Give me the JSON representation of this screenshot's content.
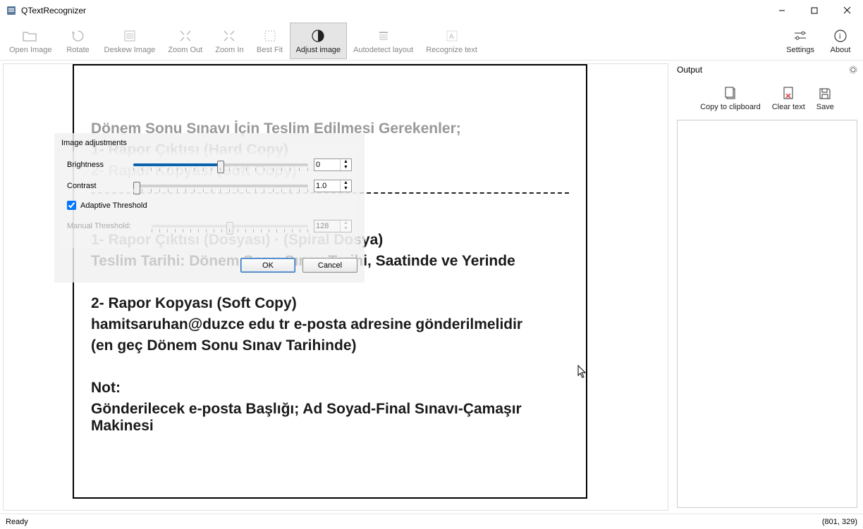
{
  "app": {
    "title": "QTextRecognizer"
  },
  "toolbar": {
    "open": "Open Image",
    "rotate": "Rotate",
    "deskew": "Deskew Image",
    "zoom_out": "Zoom Out",
    "zoom_in": "Zoom In",
    "best_fit": "Best Fit",
    "adjust": "Adjust image",
    "autodetect": "Autodetect layout",
    "recognize": "Recognize text",
    "settings": "Settings",
    "about": "About"
  },
  "output": {
    "title": "Output",
    "copy": "Copy to clipboard",
    "clear": "Clear text",
    "save": "Save"
  },
  "dialog": {
    "title": "Image adjustments",
    "brightness_label": "Brightness",
    "brightness_value": "0",
    "contrast_label": "Contrast",
    "contrast_value": "1.0",
    "adaptive_label": "Adaptive Threshold",
    "adaptive_checked": true,
    "manual_label": "Manual Threshold:",
    "manual_value": "128",
    "ok": "OK",
    "cancel": "Cancel"
  },
  "document": {
    "l1": "Dönem Sonu Sınavı İçin Teslim Edilmesi Gerekenler;",
    "l2": "1- Rapor Çıktısı (Hard Copy)",
    "l3": "2- Rapor Kopyası (Soft Copy)",
    "l4": "1- Rapor Çıktısı (Dosyası)   ·   (Spiral Dosya)",
    "l5": "Teslim Tarihi: Dönem Sonu Sınav Tarihi, Saatinde ve Yerinde",
    "l6": "2- Rapor Kopyası (Soft Copy)",
    "l7": "hamitsaruhan@duzce edu tr      e-posta adresine gönderilmelidir",
    "l8": "(en geç Dönem Sonu Sınav Tarihinde)",
    "l9": "Not:",
    "l10": "Gönderilecek e-posta Başlığı; Ad Soyad-Final Sınavı-Çamaşır Makinesi"
  },
  "status": {
    "ready": "Ready",
    "coords": "(801, 329)"
  }
}
